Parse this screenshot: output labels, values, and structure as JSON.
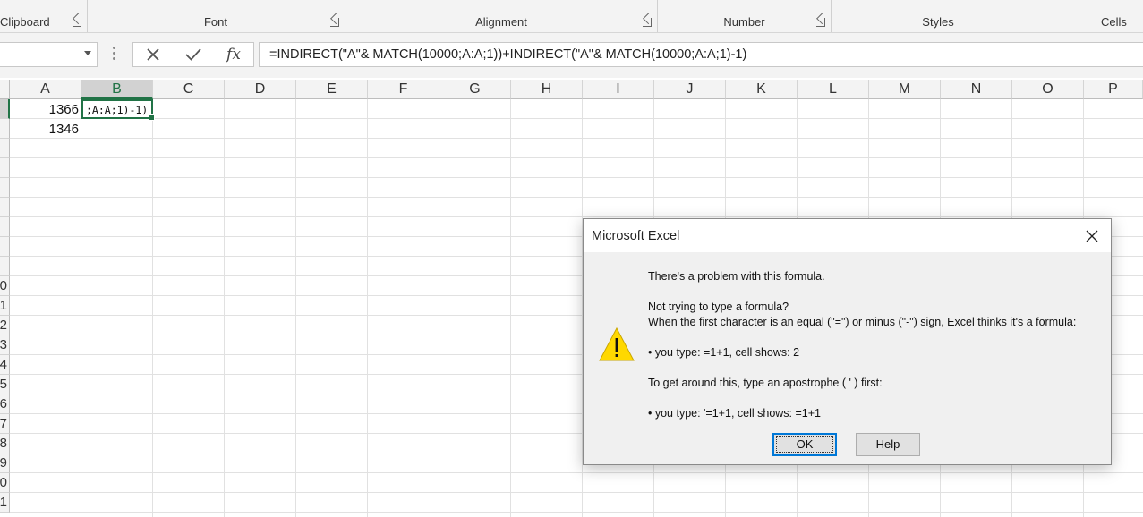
{
  "ribbon": {
    "groups": [
      "Clipboard",
      "Font",
      "Alignment",
      "Number",
      "Styles",
      "Cells"
    ]
  },
  "formula_bar": {
    "name_box": "",
    "cancel_icon": "x-icon",
    "enter_icon": "check-icon",
    "fx_label": "fx",
    "formula": "=INDIRECT(\"A\"& MATCH(10000;A:A;1))+INDIRECT(\"A\"& MATCH(10000;A:A;1)-1)"
  },
  "grid": {
    "columns": [
      "A",
      "B",
      "C",
      "D",
      "E",
      "F",
      "G",
      "H",
      "I",
      "J",
      "K",
      "L",
      "M",
      "N",
      "O",
      "P"
    ],
    "row_numbers": [
      "",
      "",
      "",
      "",
      "",
      "",
      "",
      "",
      "",
      "0",
      "1",
      "2",
      "3",
      "4",
      "5",
      "6",
      "7",
      "8",
      "9",
      "0",
      "1"
    ],
    "cells": {
      "A1": "1366",
      "A2": "1346",
      "B1_editing": ";A:A;1)-1)"
    },
    "selected_column": "B"
  },
  "dialog": {
    "title": "Microsoft Excel",
    "close_icon": "close-icon",
    "warning_icon": "warning-icon",
    "lines": [
      "There's a problem with this formula.",
      "Not trying to type a formula?",
      "When the first character is an equal (\"=\") or minus (\"-\") sign, Excel thinks it's a formula:",
      "• you type:   =1+1, cell shows:   2",
      "To get around this, type an apostrophe ( ' ) first:",
      "• you type:   '=1+1, cell shows:   =1+1"
    ],
    "ok_label": "OK",
    "help_label": "Help"
  },
  "colors": {
    "accent_green": "#217346",
    "warning_yellow": "#ffd800",
    "focus_blue": "#0078d7"
  }
}
